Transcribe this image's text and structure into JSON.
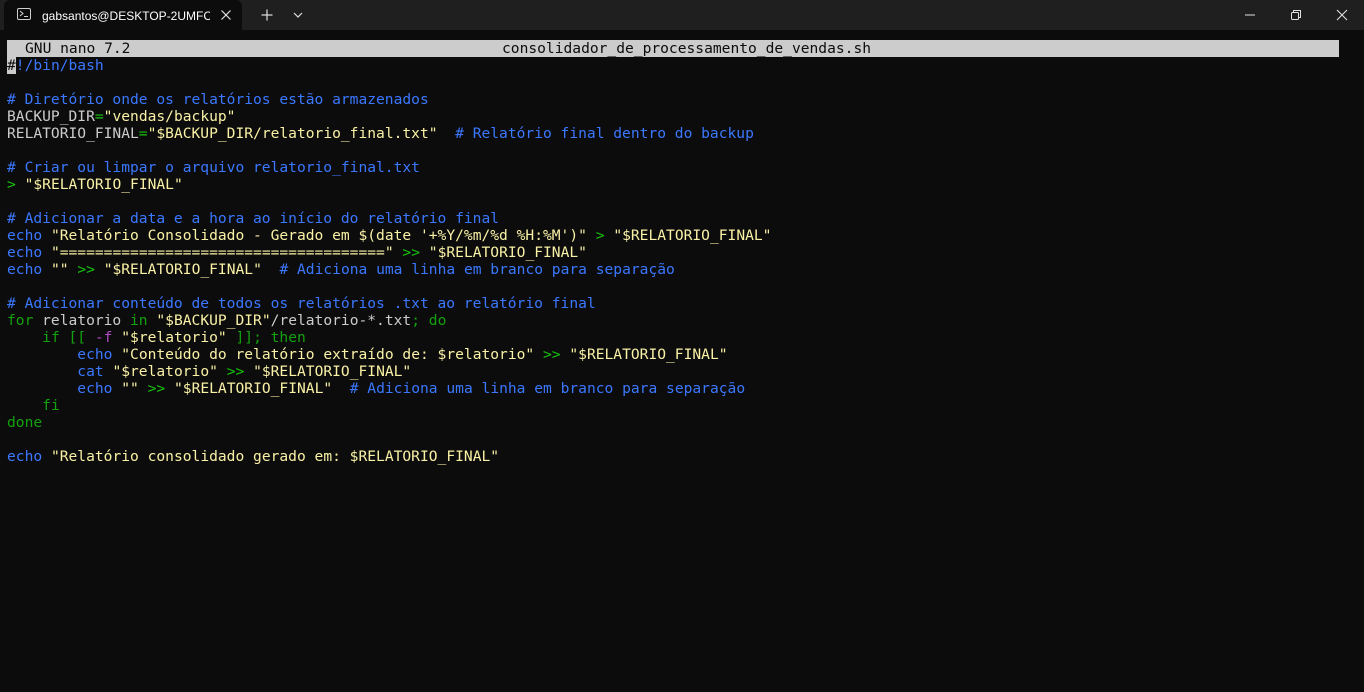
{
  "window": {
    "tab_title": "gabsantos@DESKTOP-2UMFC",
    "icons": {
      "tab": "terminal-icon",
      "close_tab": "close-icon",
      "new_tab": "plus-icon",
      "dropdown": "chevron-down-icon",
      "minimize": "minimize-icon",
      "maximize": "restore-icon",
      "close": "close-icon"
    }
  },
  "nano": {
    "version": "GNU nano 7.2",
    "filename": "consolidador_de_processamento_de_vendas.sh"
  },
  "colors": {
    "background": "#0c0c0c",
    "comment": "#3b78ff",
    "string": "#f9f1a5",
    "operator": "#16c60c",
    "keyword": "#13a10e",
    "flag": "#b148c6",
    "text": "#cccccc"
  },
  "code_lines": [
    [
      [
        "cursor",
        "#"
      ],
      [
        "cmt",
        "!/bin/bash"
      ]
    ],
    [],
    [
      [
        "cmt",
        "# Diretório onde os relatórios estão armazenados"
      ]
    ],
    [
      [
        "txt",
        "BACKUP_DIR"
      ],
      [
        "op",
        "="
      ],
      [
        "str",
        "\"vendas/backup\""
      ]
    ],
    [
      [
        "txt",
        "RELATORIO_FINAL"
      ],
      [
        "op",
        "="
      ],
      [
        "str",
        "\"$BACKUP_DIR/relatorio_final.txt\""
      ],
      [
        "txt",
        "  "
      ],
      [
        "cmt",
        "# Relatório final dentro do backup"
      ]
    ],
    [],
    [
      [
        "cmt",
        "# Criar ou limpar o arquivo relatorio_final.txt"
      ]
    ],
    [
      [
        "op",
        ">"
      ],
      [
        "txt",
        " "
      ],
      [
        "str",
        "\"$RELATORIO_FINAL\""
      ]
    ],
    [],
    [
      [
        "cmt",
        "# Adicionar a data e a hora ao início do relatório final"
      ]
    ],
    [
      [
        "bi",
        "echo"
      ],
      [
        "txt",
        " "
      ],
      [
        "str",
        "\"Relatório Consolidado - Gerado em $(date '+%Y/%m/%d %H:%M')\""
      ],
      [
        "txt",
        " "
      ],
      [
        "op",
        ">"
      ],
      [
        "txt",
        " "
      ],
      [
        "str",
        "\"$RELATORIO_FINAL\""
      ]
    ],
    [
      [
        "bi",
        "echo"
      ],
      [
        "txt",
        " "
      ],
      [
        "str",
        "\"=====================================\""
      ],
      [
        "txt",
        " "
      ],
      [
        "op",
        ">>"
      ],
      [
        "txt",
        " "
      ],
      [
        "str",
        "\"$RELATORIO_FINAL\""
      ]
    ],
    [
      [
        "bi",
        "echo"
      ],
      [
        "txt",
        " "
      ],
      [
        "str",
        "\"\""
      ],
      [
        "txt",
        " "
      ],
      [
        "op",
        ">>"
      ],
      [
        "txt",
        " "
      ],
      [
        "str",
        "\"$RELATORIO_FINAL\""
      ],
      [
        "txt",
        "  "
      ],
      [
        "cmt",
        "# Adiciona uma linha em branco para separação"
      ]
    ],
    [],
    [
      [
        "cmt",
        "# Adicionar conteúdo de todos os relatórios .txt ao relatório final"
      ]
    ],
    [
      [
        "kw",
        "for"
      ],
      [
        "txt",
        " relatorio "
      ],
      [
        "kw",
        "in"
      ],
      [
        "txt",
        " "
      ],
      [
        "str",
        "\"$BACKUP_DIR\""
      ],
      [
        "txt",
        "/relatorio-*.txt"
      ],
      [
        "kw",
        "; do"
      ]
    ],
    [
      [
        "txt",
        "    "
      ],
      [
        "kw",
        "if [["
      ],
      [
        "txt",
        " "
      ],
      [
        "flag",
        "-f"
      ],
      [
        "txt",
        " "
      ],
      [
        "str",
        "\"$relatorio\""
      ],
      [
        "txt",
        " "
      ],
      [
        "kw",
        "]]; then"
      ]
    ],
    [
      [
        "txt",
        "        "
      ],
      [
        "bi",
        "echo"
      ],
      [
        "txt",
        " "
      ],
      [
        "str",
        "\"Conteúdo do relatório extraído de: $relatorio\""
      ],
      [
        "txt",
        " "
      ],
      [
        "op",
        ">>"
      ],
      [
        "txt",
        " "
      ],
      [
        "str",
        "\"$RELATORIO_FINAL\""
      ]
    ],
    [
      [
        "txt",
        "        "
      ],
      [
        "bi",
        "cat"
      ],
      [
        "txt",
        " "
      ],
      [
        "str",
        "\"$relatorio\""
      ],
      [
        "txt",
        " "
      ],
      [
        "op",
        ">>"
      ],
      [
        "txt",
        " "
      ],
      [
        "str",
        "\"$RELATORIO_FINAL\""
      ]
    ],
    [
      [
        "txt",
        "        "
      ],
      [
        "bi",
        "echo"
      ],
      [
        "txt",
        " "
      ],
      [
        "str",
        "\"\""
      ],
      [
        "txt",
        " "
      ],
      [
        "op",
        ">>"
      ],
      [
        "txt",
        " "
      ],
      [
        "str",
        "\"$RELATORIO_FINAL\""
      ],
      [
        "txt",
        "  "
      ],
      [
        "cmt",
        "# Adiciona uma linha em branco para separação"
      ]
    ],
    [
      [
        "txt",
        "    "
      ],
      [
        "kw",
        "fi"
      ]
    ],
    [
      [
        "kw",
        "done"
      ]
    ],
    [],
    [
      [
        "bi",
        "echo"
      ],
      [
        "txt",
        " "
      ],
      [
        "str",
        "\"Relatório consolidado gerado em: $RELATORIO_FINAL\""
      ]
    ]
  ]
}
